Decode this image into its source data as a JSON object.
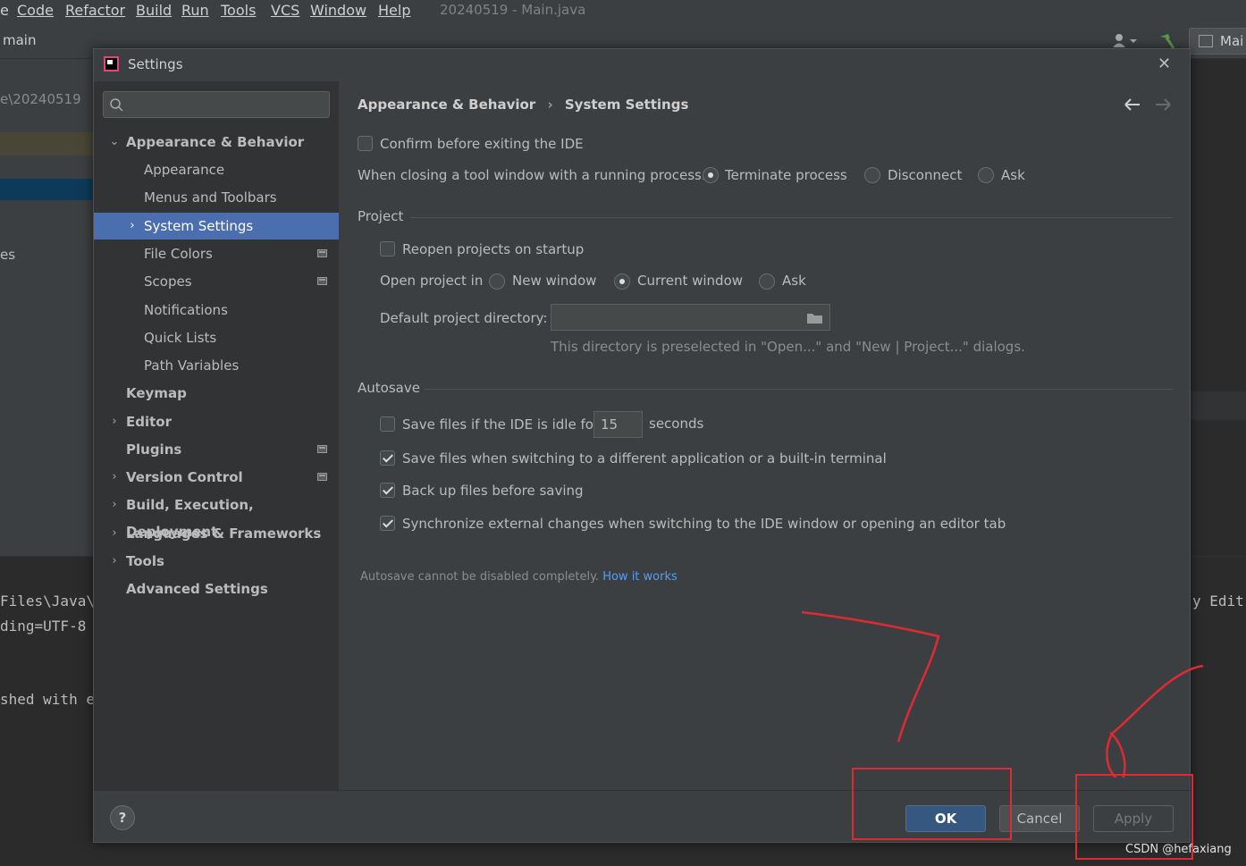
{
  "ide": {
    "menu": [
      "Code",
      "Refactor",
      "Build",
      "Run",
      "Tools",
      "VCS",
      "Window",
      "Help"
    ],
    "menu_first_fragment": "e",
    "window_title": "20240519 - Main.java",
    "branch": "main",
    "run_config": "Mai",
    "project_path": "e\\20240519",
    "left_fragment": "es",
    "console_lines": [
      "Files\\Java\\",
      "ding=UTF-8",
      "shed with e"
    ],
    "console_right": "y Edit",
    "watermark": "CSDN @hefaxiang"
  },
  "dialog": {
    "title": "Settings",
    "close_glyph": "✕",
    "search_placeholder": "",
    "tree": [
      {
        "label": "Appearance & Behavior",
        "expanded": true
      },
      {
        "label": "Appearance"
      },
      {
        "label": "Menus and Toolbars"
      },
      {
        "label": "System Settings",
        "selected": true
      },
      {
        "label": "File Colors"
      },
      {
        "label": "Scopes"
      },
      {
        "label": "Notifications"
      },
      {
        "label": "Quick Lists"
      },
      {
        "label": "Path Variables"
      },
      {
        "label": "Keymap"
      },
      {
        "label": "Editor"
      },
      {
        "label": "Plugins"
      },
      {
        "label": "Version Control"
      },
      {
        "label": "Build, Execution, Deployment"
      },
      {
        "label": "Languages & Frameworks"
      },
      {
        "label": "Tools"
      },
      {
        "label": "Advanced Settings"
      }
    ],
    "breadcrumb": {
      "parent": "Appearance & Behavior",
      "separator": "›",
      "current": "System Settings"
    },
    "confirm_exit": {
      "label": "Confirm before exiting the IDE",
      "checked": false
    },
    "closing_tool": {
      "label": "When closing a tool window with a running process:",
      "options": [
        "Terminate process",
        "Disconnect",
        "Ask"
      ],
      "selected": "Terminate process"
    },
    "project": {
      "section": "Project",
      "reopen": {
        "label": "Reopen projects on startup",
        "checked": false
      },
      "open_in": {
        "label": "Open project in",
        "options": [
          "New window",
          "Current window",
          "Ask"
        ],
        "selected": "Current window"
      },
      "default_dir": {
        "label": "Default project directory:",
        "value": "",
        "hint": "This directory is preselected in \"Open...\" and \"New | Project...\" dialogs."
      }
    },
    "autosave": {
      "section": "Autosave",
      "idle": {
        "label": "Save files if the IDE is idle for",
        "value": "15",
        "unit": "seconds",
        "checked": false
      },
      "switching": {
        "label": "Save files when switching to a different application or a built-in terminal",
        "checked": true
      },
      "backup": {
        "label": "Back up files before saving",
        "checked": true
      },
      "sync": {
        "label": "Synchronize external changes when switching to the IDE window or opening an editor tab",
        "checked": true
      },
      "note": "Autosave cannot be disabled completely.",
      "note_link": "How it works"
    },
    "footer": {
      "help": "?",
      "ok": "OK",
      "cancel": "Cancel",
      "apply": "Apply"
    }
  },
  "colors": {
    "selection": "#4b6eaf",
    "primary_button": "#365880",
    "link": "#589df6",
    "annotation": "#e02a33"
  }
}
